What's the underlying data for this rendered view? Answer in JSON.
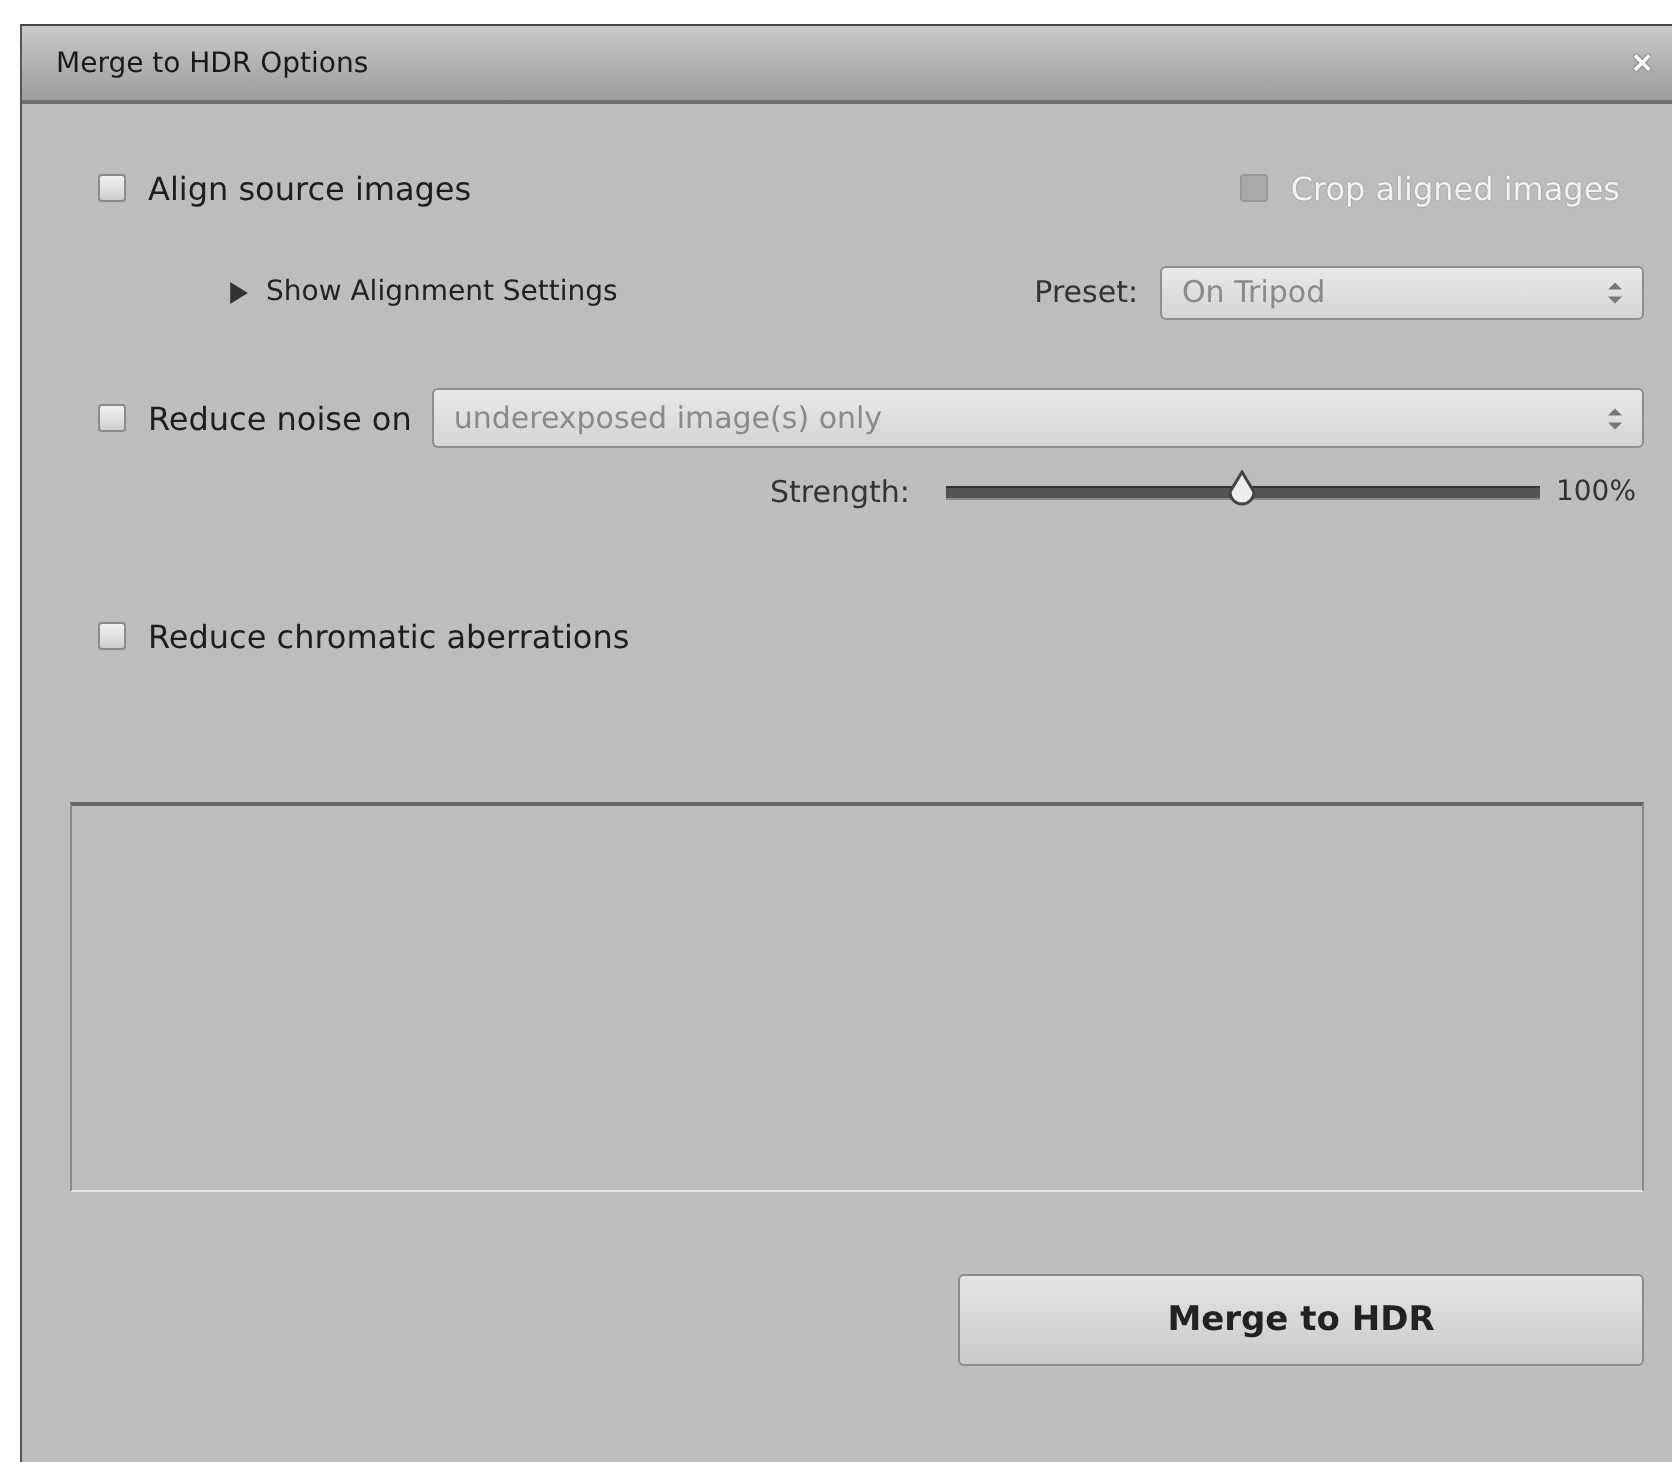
{
  "window": {
    "title": "Merge to HDR Options",
    "close": "×"
  },
  "align_source": {
    "label": "Align source images",
    "checked": false
  },
  "crop_aligned": {
    "label": "Crop aligned images",
    "checked": false,
    "disabled": true
  },
  "alignment_settings": {
    "label": "Show Alignment Settings",
    "expanded": false
  },
  "preset": {
    "label": "Preset:",
    "value": "On Tripod",
    "disabled": true
  },
  "reduce_noise": {
    "label": "Reduce noise on",
    "checked": false,
    "value": "underexposed image(s) only",
    "disabled": true
  },
  "strength": {
    "label": "Strength:",
    "level": 0.5,
    "reading": "100%"
  },
  "chromatic": {
    "label": "Reduce chromatic aberrations",
    "checked": false
  },
  "buttons": [
    "Merge to HDR"
  ]
}
